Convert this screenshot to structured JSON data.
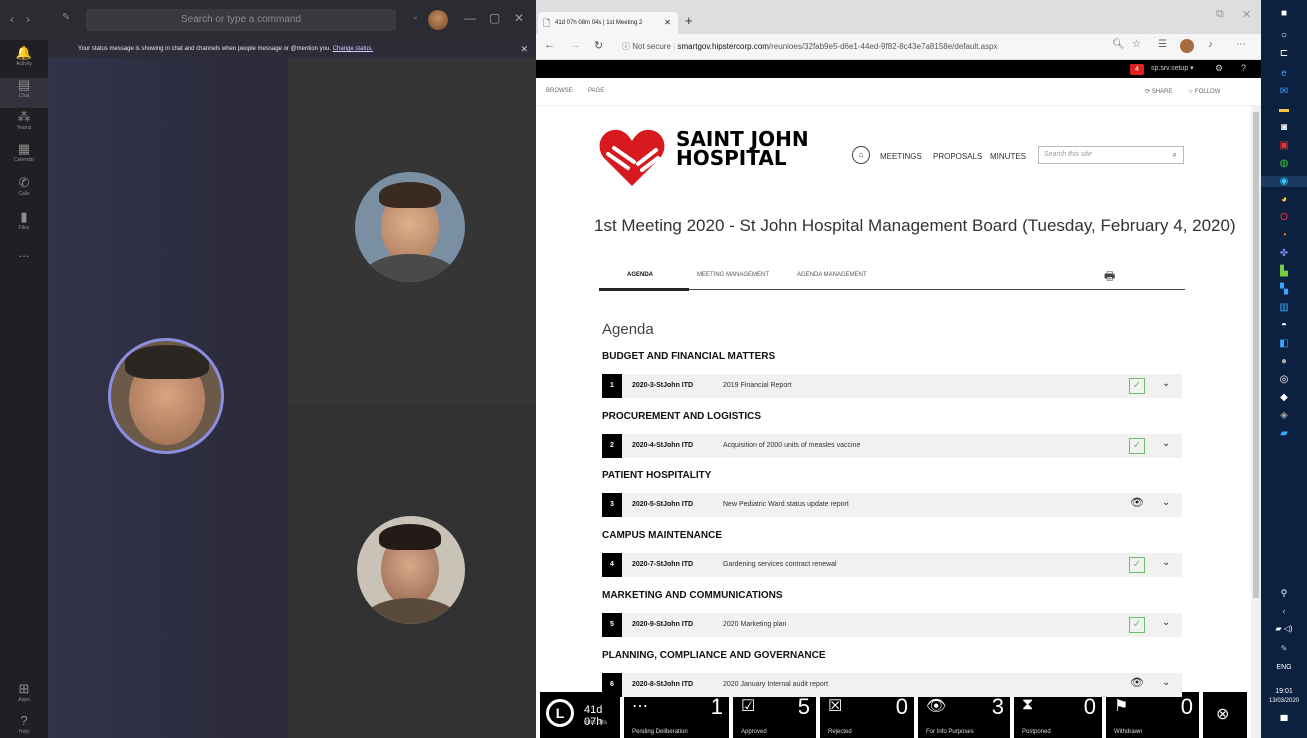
{
  "teams": {
    "search_placeholder": "Search or type a command",
    "banner_text": "Your status message is showing in chat and channels when people message or @mention you. ",
    "banner_link": "Change status.",
    "rail": [
      {
        "label": "Activity",
        "icon": "bell-icon"
      },
      {
        "label": "Chat",
        "icon": "chat-icon"
      },
      {
        "label": "Teams",
        "icon": "teams-icon"
      },
      {
        "label": "Calendar",
        "icon": "calendar-icon"
      },
      {
        "label": "Calls",
        "icon": "phone-icon"
      },
      {
        "label": "Files",
        "icon": "file-icon"
      },
      {
        "label": "...",
        "icon": "more-icon"
      }
    ],
    "rail_bottom": [
      {
        "label": "Apps",
        "icon": "apps-icon"
      },
      {
        "label": "Help",
        "icon": "help-icon"
      }
    ]
  },
  "browser": {
    "tab_title": "41d 07h 08m 04s | 1st Meeting 2",
    "url_security": "Not secure",
    "url_host": "smartgov.hipstercorp.com",
    "url_path": "/reunioes/32fab9e5-d6e1-44ed-9f82-8c43e7a8158e/default.aspx"
  },
  "sharepoint": {
    "notification_count": "4",
    "user": "sp.srv.setup ▾",
    "ribbon_browse": "BROWSE",
    "ribbon_page": "PAGE",
    "share": "SHARE",
    "follow": "FOLLOW"
  },
  "site": {
    "logo_line1": "SAINT JOHN",
    "logo_line2": "HOSPITAL",
    "nav_meetings": "MEETINGS",
    "nav_proposals": "PROPOSALS",
    "nav_minutes": "MINUTES",
    "search_placeholder": "Search this site"
  },
  "meeting": {
    "title": "1st Meeting 2020 - St John Hospital Management Board (Tuesday, February 4, 2020)",
    "tabs": [
      "AGENDA",
      "MEETING MANAGEMENT",
      "AGENDA MANAGEMENT"
    ],
    "agenda_heading": "Agenda"
  },
  "agenda": [
    {
      "category": "BUDGET AND FINANCIAL MATTERS",
      "num": "1",
      "code": "2020-3-StJohn ITD",
      "desc": "2019 Financial Report",
      "status": "approved"
    },
    {
      "category": "PROCUREMENT AND LOGISTICS",
      "num": "2",
      "code": "2020-4-StJohn ITD",
      "desc": "Acquisition of 2000 units of measles vaccine",
      "status": "approved"
    },
    {
      "category": "PATIENT HOSPITALITY",
      "num": "3",
      "code": "2020-5-StJohn ITD",
      "desc": "New Pediatric Ward status update report",
      "status": "for-info"
    },
    {
      "category": "CAMPUS MAINTENANCE",
      "num": "4",
      "code": "2020-7-StJohn ITD",
      "desc": "Gardening services contract renewal",
      "status": "approved"
    },
    {
      "category": "MARKETING AND COMMUNICATIONS",
      "num": "5",
      "code": "2020-9-StJohn ITD",
      "desc": "2020 Marketing plan",
      "status": "approved"
    },
    {
      "category": "PLANNING, COMPLIANCE AND GOVERNANCE",
      "num": "6",
      "code": "2020-8-StJohn ITD",
      "desc": "2020 January Internal audit report",
      "status": "for-info"
    }
  ],
  "bottom_bar": {
    "timer_main": "41d 07h",
    "timer_sub": "08m 04s",
    "counters": [
      {
        "label": "Pending Deliberation",
        "count": "1",
        "icon": "ellipsis-icon"
      },
      {
        "label": "Approved",
        "count": "5",
        "icon": "check-box-icon"
      },
      {
        "label": "Rejected",
        "count": "0",
        "icon": "x-box-icon"
      },
      {
        "label": "For Info Purposes",
        "count": "3",
        "icon": "eye-icon"
      },
      {
        "label": "Postponed",
        "count": "0",
        "icon": "hourglass-icon"
      },
      {
        "label": "Withdrawn",
        "count": "0",
        "icon": "flag-icon"
      }
    ]
  },
  "taskbar": {
    "language": "ENG",
    "time": "19:01",
    "date": "13/03/2020"
  }
}
